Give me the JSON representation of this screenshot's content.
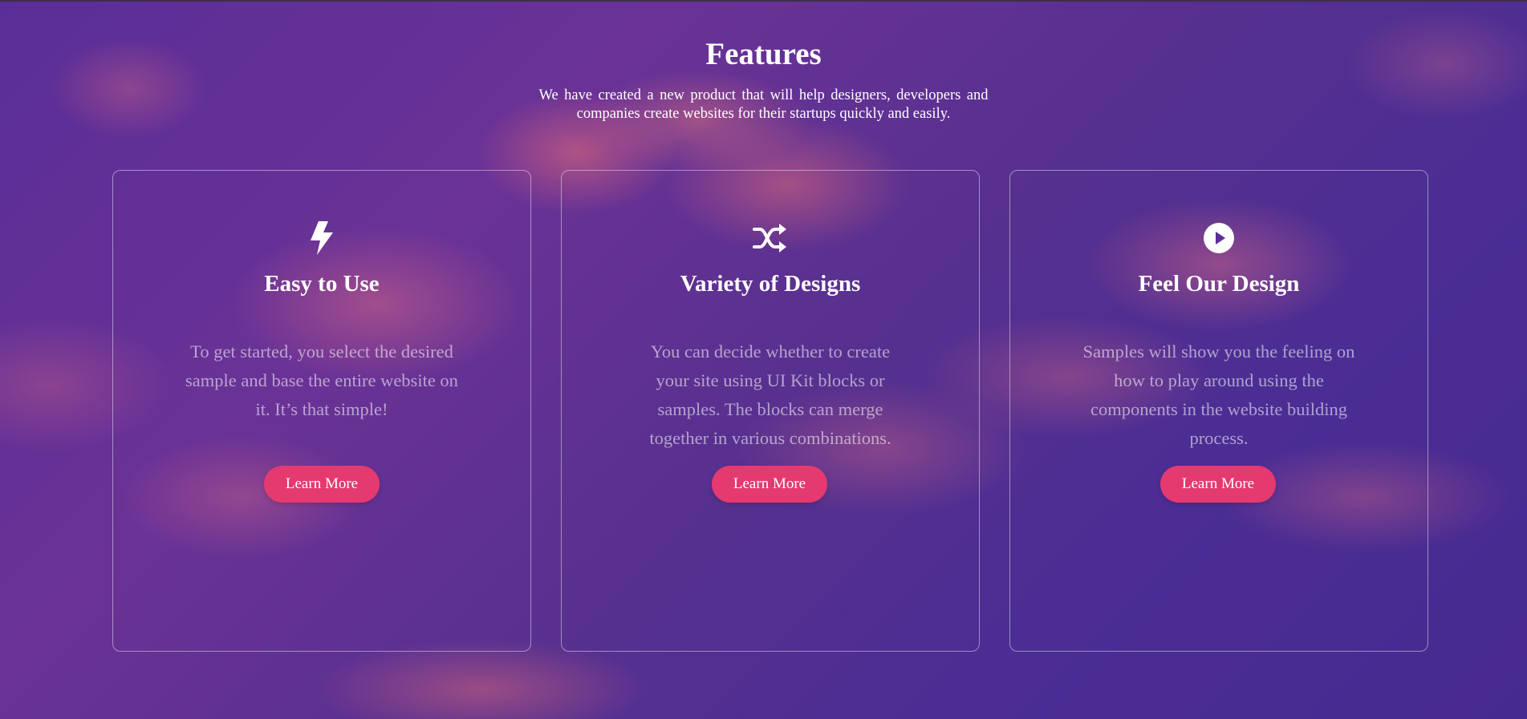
{
  "features": {
    "title": "Features",
    "subtitle": "We have created a new product that will help designers, developers and companies create websites for their startups quickly and easily."
  },
  "cards": [
    {
      "icon": "lightning-bolt-icon",
      "title": "Easy to Use",
      "text": "To get started, you select the desired sample and base the entire website on it. It’s that simple!",
      "button": "Learn More"
    },
    {
      "icon": "shuffle-icon",
      "title": "Variety of Designs",
      "text": "You can decide whether to create your site using UI Kit blocks or samples. The blocks can merge together in various combinations.",
      "button": "Learn More"
    },
    {
      "icon": "play-circle-icon",
      "title": "Feel Our Design",
      "text": "Samples will show you the feeling on how to play around using the components in the website building process.",
      "button": "Learn More"
    }
  ],
  "colors": {
    "accent": "#e53a6f",
    "background": "#4a2a8e",
    "text": "#ffffff"
  }
}
